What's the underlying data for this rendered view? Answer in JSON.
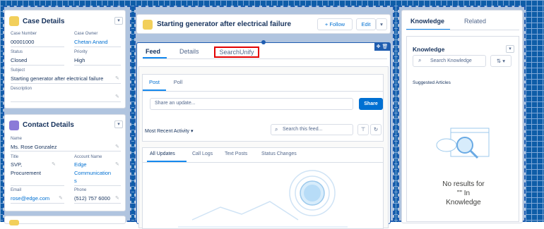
{
  "case_details": {
    "title": "Case Details",
    "fields": [
      {
        "label": "Case Number",
        "value": "00001000"
      },
      {
        "label": "Case Owner",
        "value": "Chetan Anand"
      },
      {
        "label": "Status",
        "value": "Closed"
      },
      {
        "label": "Priority",
        "value": "High"
      },
      {
        "label": "Subject",
        "value": "Starting generator after electrical failure"
      },
      {
        "label": "Description",
        "value": ""
      }
    ]
  },
  "contact_details": {
    "title": "Contact Details",
    "fields": [
      {
        "label": "Name",
        "value": "Ms. Rose Gonzalez"
      },
      {
        "label": "Title",
        "value_lines": [
          "SVP,",
          "Procurement"
        ]
      },
      {
        "label": "Account Name",
        "value_lines": [
          "Edge",
          "Communication",
          "s"
        ]
      },
      {
        "label": "Email",
        "value": "rose@edge.com"
      },
      {
        "label": "Phone",
        "value": "(512) 757 6000"
      }
    ]
  },
  "header": {
    "title": "Starting generator after electrical failure",
    "follow_label": "Follow",
    "edit_label": "Edit"
  },
  "main": {
    "tabs": [
      "Feed",
      "Details",
      "SearchUnify"
    ]
  },
  "publisher": {
    "tabs": [
      "Post",
      "Poll"
    ],
    "placeholder": "Share an update...",
    "share_label": "Share"
  },
  "feed": {
    "sort_label": "Most Recent Activity",
    "search_placeholder": "Search this feed...",
    "filters": [
      "All Updates",
      "Call Logs",
      "Text Posts",
      "Status Changes"
    ]
  },
  "right_panel": {
    "tabs": [
      "Knowledge",
      "Related"
    ]
  },
  "knowledge": {
    "title": "Knowledge",
    "search_placeholder": "Search Knowledge",
    "suggested_label": "Suggested Articles",
    "empty_lines": [
      "No results for",
      "\"\" In",
      "Knowledge"
    ]
  },
  "colors": {
    "accent": "#1589ee",
    "link": "#0070d2",
    "highlight_box": "#e30000",
    "canvas_blue": "#0e5da8"
  }
}
